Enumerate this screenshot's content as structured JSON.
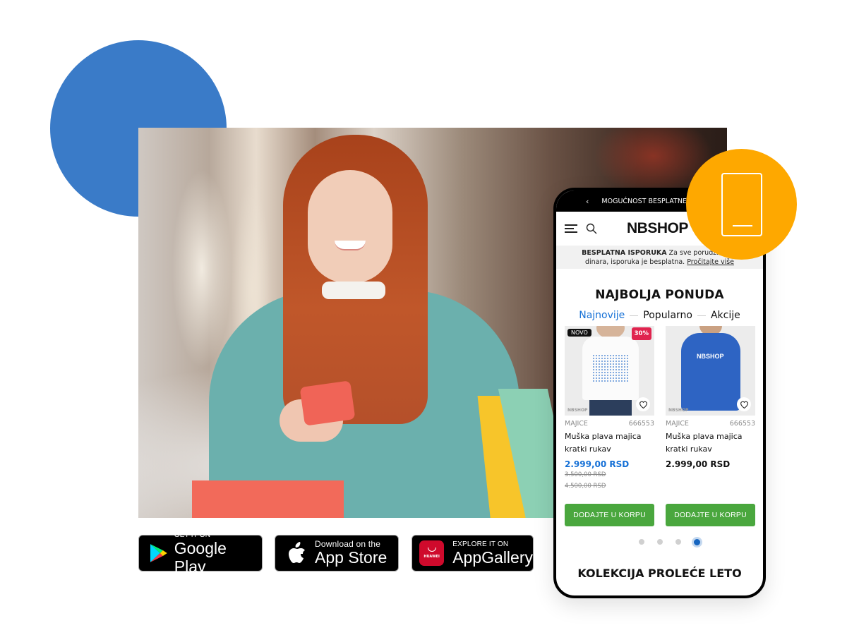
{
  "decor": {
    "blue_circle_color": "#3a7bc8",
    "orange_circle_color": "#fea800",
    "orange_circle_icon": "smartphone-icon"
  },
  "hero_image": {
    "alt": "Smiling red-haired woman in teal sweater looking at phone holding shopping bags in a mall"
  },
  "store_badges": [
    {
      "small": "GET IT ON",
      "big": "Google Play",
      "icon": "google-play-icon"
    },
    {
      "small": "Download on the",
      "big": "App Store",
      "icon": "apple-icon"
    },
    {
      "small": "EXPLORE IT ON",
      "big": "AppGallery",
      "icon": "huawei-icon",
      "icon_text": "HUAWEI"
    }
  ],
  "phone": {
    "topbar": {
      "chevron": "‹",
      "text": "MOGUĆNOST BESPLATNE IS"
    },
    "header": {
      "logo": "NBSHOP",
      "menu_icon": "hamburger-menu-icon",
      "search_icon": "search-icon"
    },
    "notice": {
      "bold": "BESPLATNA ISPORUKA",
      "text1": " Za sve porudžbine p",
      "text2": "dinara, isporuka je besplatna. ",
      "link": "Pročitajte više"
    },
    "section_title": "NAJBOLJA PONUDA",
    "tabs": [
      {
        "label": "Najnovije",
        "active": true
      },
      {
        "label": "Popularno",
        "active": false
      },
      {
        "label": "Akcije",
        "active": false
      }
    ],
    "products": [
      {
        "badge_new": "NOVO",
        "badge_sale": "30%",
        "watermark": "NBSHOP",
        "category": "MAJICE",
        "sku": "666553",
        "name_line1": "Muška plava majica",
        "name_line2": "kratki rukav",
        "price": "2.999,00 RSD",
        "old_prices": [
          "3.500,00 RSD",
          "4.500,00 RSD"
        ],
        "cta": "DODAJTE U KORPU"
      },
      {
        "watermark": "NBSHOP",
        "print": "NBSHOP",
        "category": "MAJICE",
        "sku": "666553",
        "name_line1": "Muška plava majica",
        "name_line2": "kratki rukav",
        "price": "2.999,00 RSD",
        "cta": "DODAJTE U KORPU"
      }
    ],
    "carousel": {
      "total": 4,
      "active_index": 3
    },
    "section2_title": "KOLEKCIJA PROLEĆE LETO",
    "colors": {
      "accent_blue": "#1570d6",
      "cta_green": "#4aa73e",
      "sale_red": "#e0244f"
    }
  }
}
